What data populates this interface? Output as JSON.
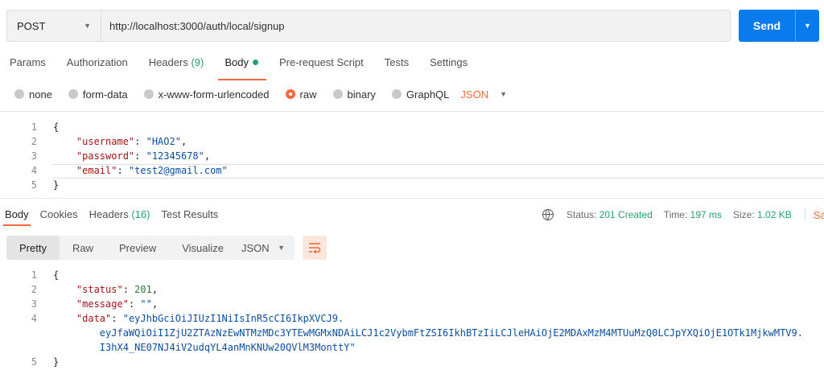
{
  "request": {
    "method": "POST",
    "url": "http://localhost:3000/auth/local/signup",
    "send_label": "Send",
    "accent_color": "#097bed"
  },
  "request_tabs": [
    {
      "label": "Params"
    },
    {
      "label": "Authorization"
    },
    {
      "label": "Headers",
      "count": "(9)"
    },
    {
      "label": "Body",
      "active": true
    },
    {
      "label": "Pre-request Script"
    },
    {
      "label": "Tests"
    },
    {
      "label": "Settings"
    }
  ],
  "body_types": [
    "none",
    "form-data",
    "x-www-form-urlencoded",
    "raw",
    "binary",
    "GraphQL"
  ],
  "body_type_selected": "raw",
  "body_language": "JSON",
  "request_body": {
    "line_numbers": [
      "1",
      "2",
      "3",
      "4",
      "5"
    ],
    "open": "{",
    "username_key": "\"username\"",
    "username_val": "\"HAO2\"",
    "password_key": "\"password\"",
    "password_val": "\"12345678\"",
    "email_key": "\"email\"",
    "email_val": "\"test2@gmail.com\"",
    "close": "}"
  },
  "response_tabs": [
    {
      "label": "Body",
      "active": true
    },
    {
      "label": "Cookies"
    },
    {
      "label": "Headers",
      "count": "(16)"
    },
    {
      "label": "Test Results"
    }
  ],
  "response_meta": {
    "status_label": "Status:",
    "status_value": "201 Created",
    "time_label": "Time:",
    "time_value": "197 ms",
    "size_label": "Size:",
    "size_value": "1.02 KB",
    "save_label": "Sav"
  },
  "view_tabs": [
    "Pretty",
    "Raw",
    "Preview",
    "Visualize"
  ],
  "view_tab_active": "Pretty",
  "response_format": "JSON",
  "response_body": {
    "line_numbers": [
      "1",
      "2",
      "3",
      "4",
      "",
      "",
      "5"
    ],
    "open": "{",
    "status_key": "\"status\"",
    "status_val": "201",
    "message_key": "\"message\"",
    "message_val": "\"\"",
    "data_key": "\"data\"",
    "data_line1": "\"eyJhbGciOiJIUzI1NiIsInR5cCI6IkpXVCJ9.",
    "data_line2": "eyJfaWQiOiI1ZjU2ZTAzNzEwNTMzMDc3YTEwMGMxNDAiLCJ1c2VybmFtZSI6IkhBTzIiLCJleHAiOjE2MDAxMzM4MTUuMzQ0LCJpYXQiOjE1OTk1MjkwMTV9.",
    "data_line3": "I3hX4_NE07NJ4iV2udqYL4anMnKNUw20QVlM3MonttY\"",
    "close": "}"
  },
  "colors": {
    "accent_orange": "#f26b3a",
    "success_green": "#26a269",
    "primary_blue": "#097bed"
  }
}
